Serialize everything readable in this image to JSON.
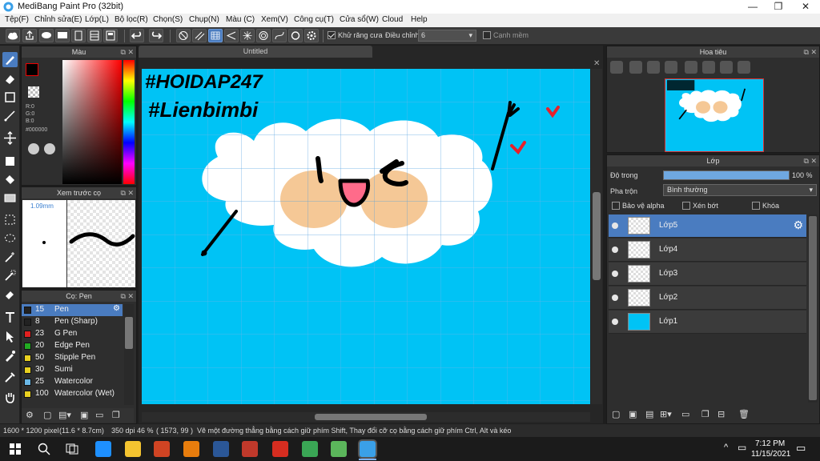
{
  "window": {
    "title": "MediBang Paint Pro (32bit)",
    "minimize": "—",
    "restore": "❐",
    "close": "✕"
  },
  "menu": [
    "Tệp(F)",
    "Chỉnh sửa(E)",
    "Lớp(L)",
    "Bộ lọc(R)",
    "Chọn(S)",
    "Chụp(N)",
    "Màu (C)",
    "Xem(V)",
    "Công cụ(T)",
    "Cửa sổ(W)",
    "Cloud",
    "Help"
  ],
  "toolbar": {
    "antialias_label": "Khử răng cưa",
    "antialias_checked": true,
    "adjust_label": "Điều chỉnh",
    "adjust_value": "6",
    "edge_label": "Cạnh mềm",
    "edge_checked": false
  },
  "color_panel": {
    "title": "Màu",
    "r": "R:0",
    "g": "G:0",
    "b": "B:0",
    "hex": "#000000",
    "primary": "#000000",
    "secondary": "#ffffff"
  },
  "brush_preview": {
    "title": "Xem trước cọ",
    "size": "1.09mm"
  },
  "brush_panel": {
    "title": "Cọ: Pen",
    "items": [
      {
        "size": "15",
        "name": "Pen",
        "color": "#222222",
        "selected": true
      },
      {
        "size": "8",
        "name": "Pen (Sharp)",
        "color": "#222222",
        "selected": false
      },
      {
        "size": "23",
        "name": "G Pen",
        "color": "#e02020",
        "selected": false
      },
      {
        "size": "20",
        "name": "Edge Pen",
        "color": "#22aa22",
        "selected": false
      },
      {
        "size": "50",
        "name": "Stipple Pen",
        "color": "#e8d020",
        "selected": false
      },
      {
        "size": "30",
        "name": "Sumi",
        "color": "#e8d020",
        "selected": false
      },
      {
        "size": "25",
        "name": "Watercolor",
        "color": "#6ab8e8",
        "selected": false
      },
      {
        "size": "100",
        "name": "Watercolor (Wet)",
        "color": "#e8d020",
        "selected": false
      }
    ]
  },
  "document": {
    "tab": "Untitled",
    "handwriting_1": "#HOIDAP247",
    "handwriting_2": "#Lienbimbi"
  },
  "navigator": {
    "title": "Hoa tiêu"
  },
  "layer_panel": {
    "title": "Lớp",
    "opacity_label": "Độ trong",
    "opacity_value": "100 %",
    "opacity": 1.0,
    "blend_label": "Pha trộn",
    "blend_value": "Bình thường",
    "protect_alpha": "Bảo vệ alpha",
    "clipping": "Xén bớt",
    "lock": "Khóa",
    "layers": [
      {
        "name": "Lớp5",
        "selected": true
      },
      {
        "name": "Lớp4",
        "selected": false
      },
      {
        "name": "Lớp3",
        "selected": false
      },
      {
        "name": "Lớp2",
        "selected": false
      },
      {
        "name": "Lớp1",
        "selected": false
      }
    ]
  },
  "status": {
    "size": "1600 * 1200 pixel",
    "cm": "(11.6 * 8.7cm)",
    "dpi": "350 dpi",
    "zoom": "46 %",
    "coords": "( 1573, 99 )",
    "hint": "Vẽ một đường thẳng bằng cách giữ phím Shift, Thay đổi cỡ cọ bằng cách giữ phím Ctrl, Alt và kéo"
  },
  "taskbar": {
    "time": "7:12 PM",
    "date": "11/15/2021"
  },
  "colors": {
    "canvas_sky": "#00c3f5",
    "accent": "#4a7cc0",
    "cheek": "#f5c896"
  }
}
